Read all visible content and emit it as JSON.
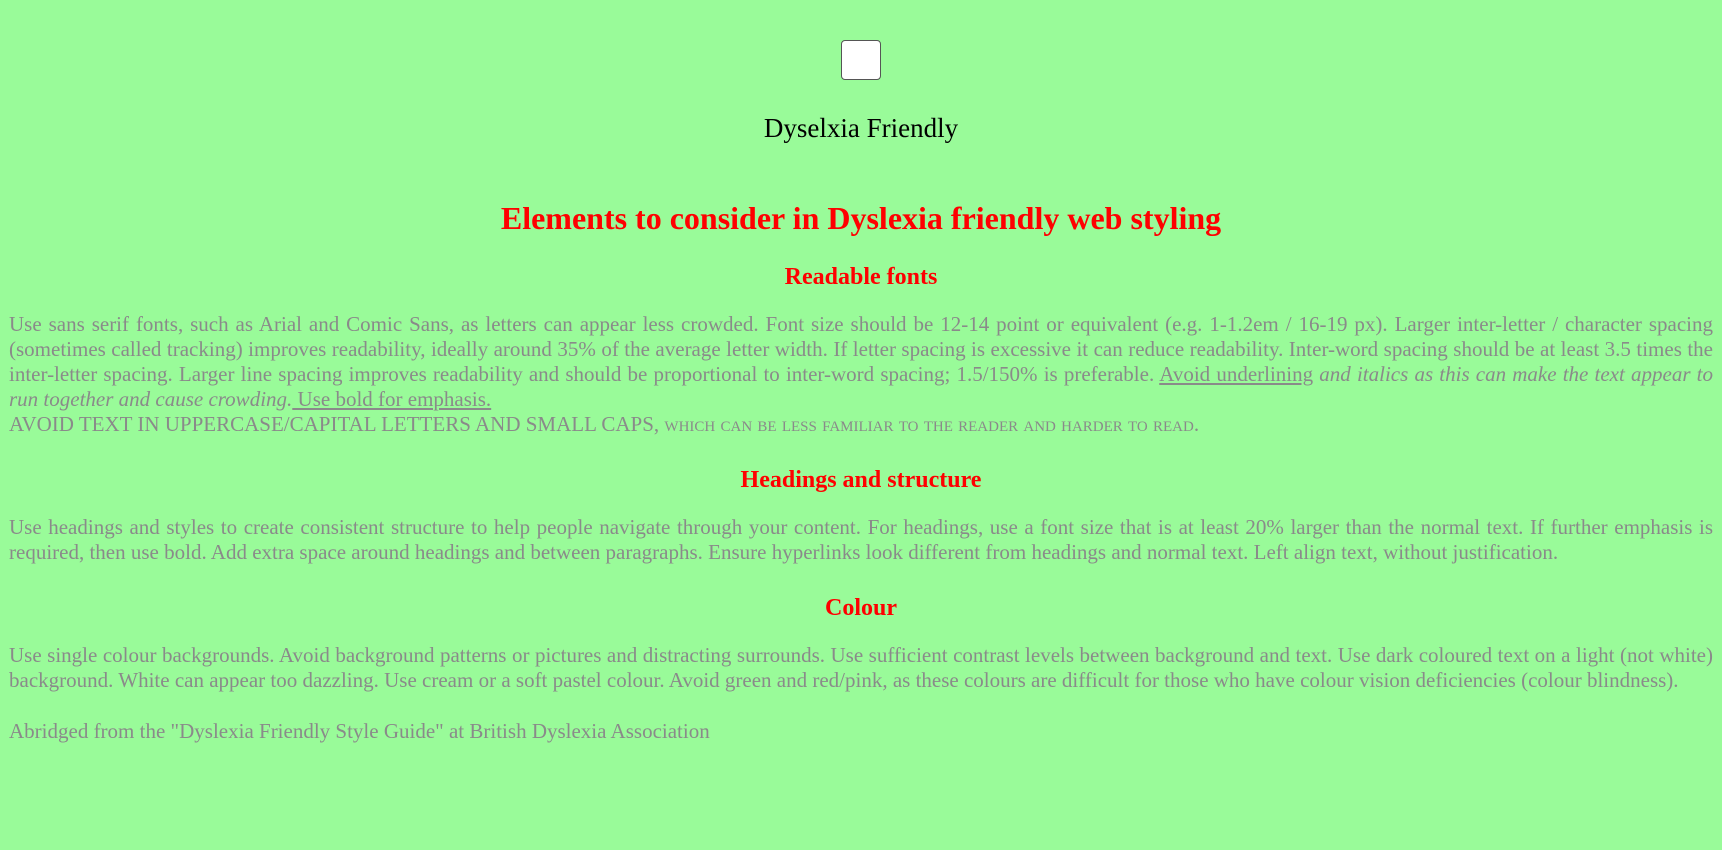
{
  "toggle": {
    "label": "Dyselxia Friendly"
  },
  "title": "Elements to consider in Dyslexia friendly web styling",
  "sections": {
    "fonts": {
      "heading": "Readable fonts",
      "text_main": "Use sans serif fonts, such as Arial and Comic Sans, as letters can appear less crowded. Font size should be 12-14 point or equivalent (e.g. 1-1.2em / 16-19 px). Larger inter-letter / character spacing (sometimes called tracking) improves readability, ideally around 35% of the average letter width. If letter spacing is excessive it can reduce readability. Inter-word spacing should be at least 3.5 times the inter-letter spacing. Larger line spacing improves readability and should be proportional to inter-word spacing; 1.5/150% is preferable. ",
      "text_underline": "Avoid underlining",
      "text_italic": " and italics as this can make the text appear to run together and cause crowding.",
      "text_bold_note": " Use bold for emphasis.",
      "text_upper": "AVOID TEXT IN UPPERCASE/CAPITAL LETTERS AND SMALL CAPS, ",
      "text_smallcaps": "which can be less familiar to the reader and harder to read."
    },
    "structure": {
      "heading": "Headings and structure",
      "text": "Use headings and styles to create consistent structure to help people navigate through your content. For headings, use a font size that is at least 20% larger than the normal text. If further emphasis is required, then use bold. Add extra space around headings and between paragraphs. Ensure hyperlinks look different from headings and normal text. Left align text, without justification."
    },
    "colour": {
      "heading": "Colour",
      "text": "Use single colour backgrounds. Avoid background patterns or pictures and distracting surrounds. Use sufficient contrast levels between background and text. Use dark coloured text on a light (not white) background. White can appear too dazzling. Use cream or a soft pastel colour. Avoid green and red/pink, as these colours are difficult for those who have colour vision deficiencies (colour blindness)."
    }
  },
  "credit": "Abridged from the \"Dyslexia Friendly Style Guide\" at British Dyslexia Association",
  "colors": {
    "background": "#99fb99",
    "heading": "#ff0000",
    "body_text": "#8a8a8a"
  }
}
